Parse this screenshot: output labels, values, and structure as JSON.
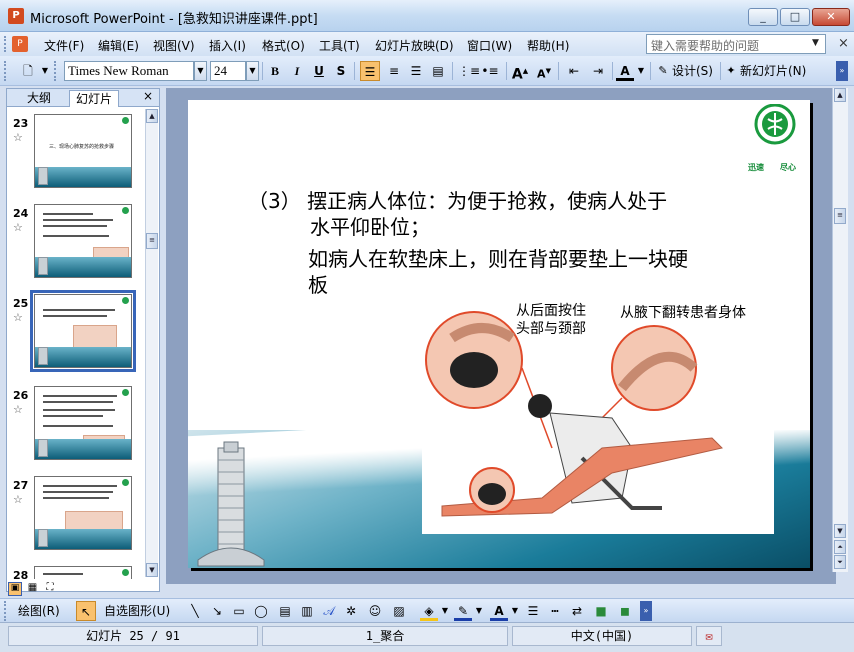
{
  "window": {
    "title": "Microsoft PowerPoint - [急救知识讲座课件.ppt]",
    "app_icon_label": "P",
    "minimize": "_",
    "maximize": "□",
    "close": "✕"
  },
  "menu": {
    "items": [
      "文件(F)",
      "编辑(E)",
      "视图(V)",
      "插入(I)",
      "格式(O)",
      "工具(T)",
      "幻灯片放映(D)",
      "窗口(W)",
      "帮助(H)"
    ],
    "help_placeholder": "键入需要帮助的问题",
    "doc_close": "×"
  },
  "toolbar": {
    "font_name": "Times New Roman",
    "font_size": "24",
    "bold": "B",
    "italic": "I",
    "underline": "U",
    "shadow": "S",
    "design_label": "设计(S)",
    "new_slide_label": "新幻灯片(N)"
  },
  "left_pane": {
    "tab_outline": "大纲",
    "tab_slides": "幻灯片",
    "close": "×",
    "slides": [
      {
        "num": "23",
        "thumb_text": "三、现场心肺复苏的抢救步骤"
      },
      {
        "num": "24",
        "thumb_text": ""
      },
      {
        "num": "25",
        "thumb_text": "",
        "selected": true
      },
      {
        "num": "26",
        "thumb_text": ""
      },
      {
        "num": "27",
        "thumb_text": ""
      },
      {
        "num": "28",
        "thumb_text": ""
      }
    ]
  },
  "slide": {
    "line1": "（3）  摆正病人体位：为便于抢救，使病人处于",
    "line2": "水平仰卧位；",
    "line3": "如病人在软垫床上，则在背部要垫上一块硬",
    "line4": "板",
    "caption1_a": "从后面按住",
    "caption1_b": "头部与颈部",
    "caption2": "从腋下翻转患者身体",
    "logo_left": "迅速",
    "logo_right": "尽心"
  },
  "drawbar": {
    "draw_label": "绘图(R)",
    "autoshape_label": "自选图形(U)"
  },
  "status": {
    "slide_count": "幻灯片 25 / 91",
    "design": "1_聚合",
    "language": "中文(中国)"
  }
}
